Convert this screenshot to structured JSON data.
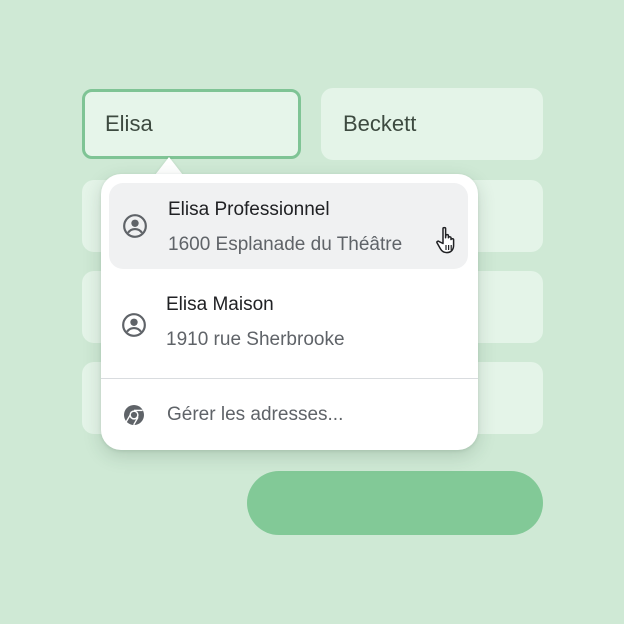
{
  "form": {
    "first_name_value": "Elisa",
    "last_name_value": "Beckett"
  },
  "suggestions": {
    "items": [
      {
        "name": "Elisa Professionnel",
        "address": "1600 Esplanade du Théâtre"
      },
      {
        "name": "Elisa Maison",
        "address": "1910 rue Sherbrooke"
      }
    ],
    "manage_label": "Gérer les adresses..."
  },
  "colors": {
    "background": "#cfe9d5",
    "field": "#e4f4e8",
    "focus_border": "#7fc495",
    "button": "#82c997",
    "hover_row": "#f0f1f2"
  },
  "icons": {
    "profile": "account-circle-icon",
    "chrome": "chrome-icon",
    "cursor": "pointer-hand-icon"
  }
}
